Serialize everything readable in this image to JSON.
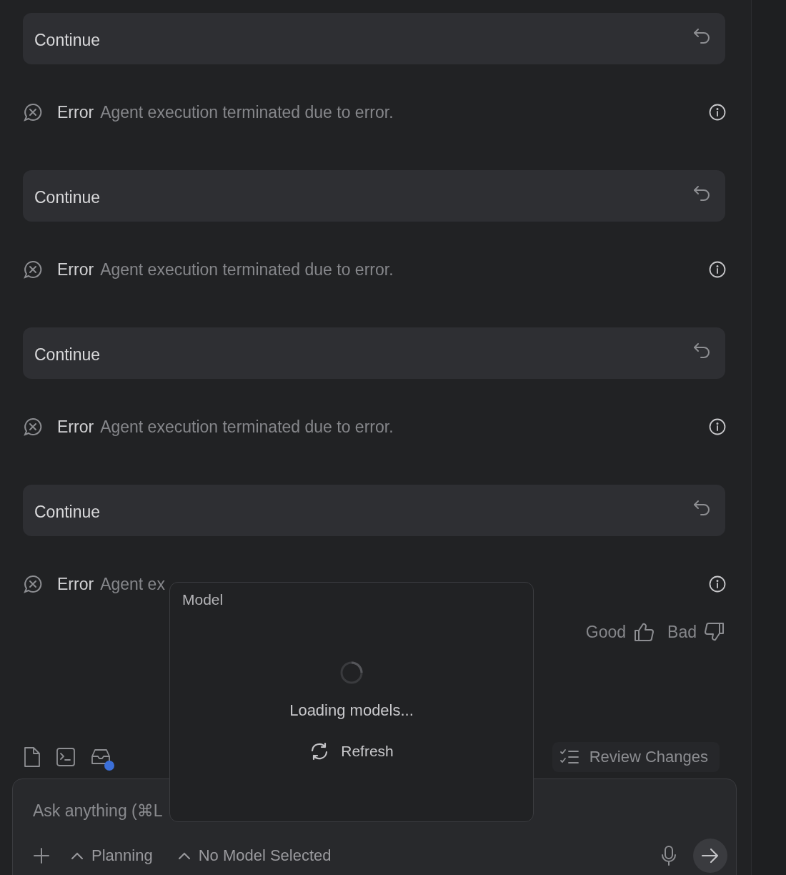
{
  "messages": [
    {
      "kind": "continue",
      "label": "Continue"
    },
    {
      "kind": "error",
      "title": "Error",
      "message": "Agent execution terminated due to error."
    },
    {
      "kind": "continue",
      "label": "Continue"
    },
    {
      "kind": "error",
      "title": "Error",
      "message": "Agent execution terminated due to error."
    },
    {
      "kind": "continue",
      "label": "Continue"
    },
    {
      "kind": "error",
      "title": "Error",
      "message": "Agent execution terminated due to error."
    },
    {
      "kind": "continue",
      "label": "Continue"
    },
    {
      "kind": "error",
      "title": "Error",
      "message": "Agent ex"
    }
  ],
  "feedback": [
    {
      "kind": "good",
      "label": "Good"
    },
    {
      "kind": "bad",
      "label": "Bad"
    }
  ],
  "context_tools": [
    {
      "kind": "file",
      "notification": false
    },
    {
      "kind": "terminal",
      "notification": false
    },
    {
      "kind": "inbox",
      "notification": true
    }
  ],
  "review_button": "Review Changes",
  "composer": {
    "placeholder": "Ask anything (⌘L",
    "mode": "Planning",
    "model": "No Model Selected"
  },
  "model_popup": {
    "title": "Model",
    "status": "Loading models...",
    "action": "Refresh"
  }
}
